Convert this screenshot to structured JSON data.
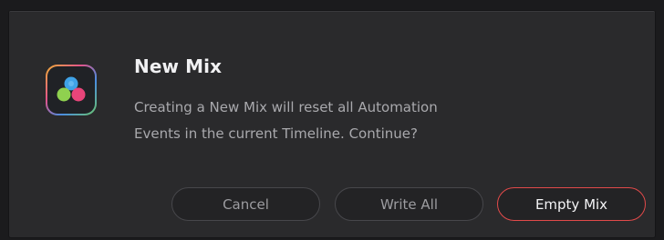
{
  "dialog": {
    "title": "New Mix",
    "message_line1": "Creating a New Mix will reset all Automation",
    "message_line2": "Events in the current Timeline. Continue?",
    "icon": "davinci-resolve-app-icon"
  },
  "buttons": {
    "cancel_label": "Cancel",
    "write_all_label": "Write All",
    "empty_mix_label": "Empty Mix"
  },
  "colors": {
    "dialog_background": "#2a2a2c",
    "primary_button_border": "#e24a4a",
    "title_text": "#f1f1f3",
    "message_text": "#a9a9ad"
  }
}
